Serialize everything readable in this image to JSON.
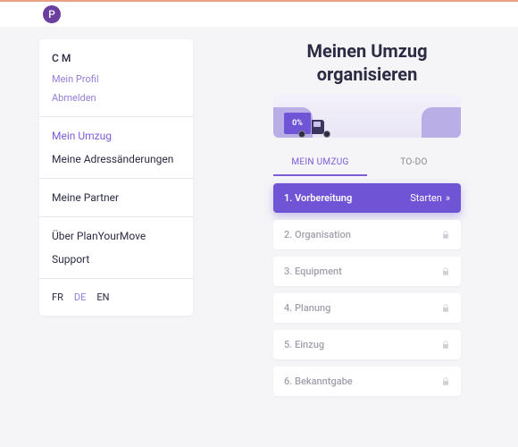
{
  "brand": {
    "logo_letter": "P"
  },
  "sidebar": {
    "user_initials": "C M",
    "profile_link": "Mein Profil",
    "logout_link": "Abmelden",
    "nav": {
      "mein_umzug": "Mein Umzug",
      "address_changes": "Meine Adressänderungen",
      "partners": "Meine Partner",
      "about": "Über PlanYourMove",
      "support": "Support"
    },
    "langs": {
      "fr": "FR",
      "de": "DE",
      "en": "EN"
    }
  },
  "main": {
    "title_line1": "Meinen Umzug",
    "title_line2": "organisieren",
    "progress": "0%",
    "tabs": {
      "mein_umzug": "MEIN UMZUG",
      "todo": "TO-DO"
    },
    "start_label": "Starten",
    "steps": [
      {
        "label": "1. Vorbereitung"
      },
      {
        "label": "2. Organisation"
      },
      {
        "label": "3. Equipment"
      },
      {
        "label": "4. Planung"
      },
      {
        "label": "5. Einzug"
      },
      {
        "label": "6. Bekanntgabe"
      }
    ]
  }
}
